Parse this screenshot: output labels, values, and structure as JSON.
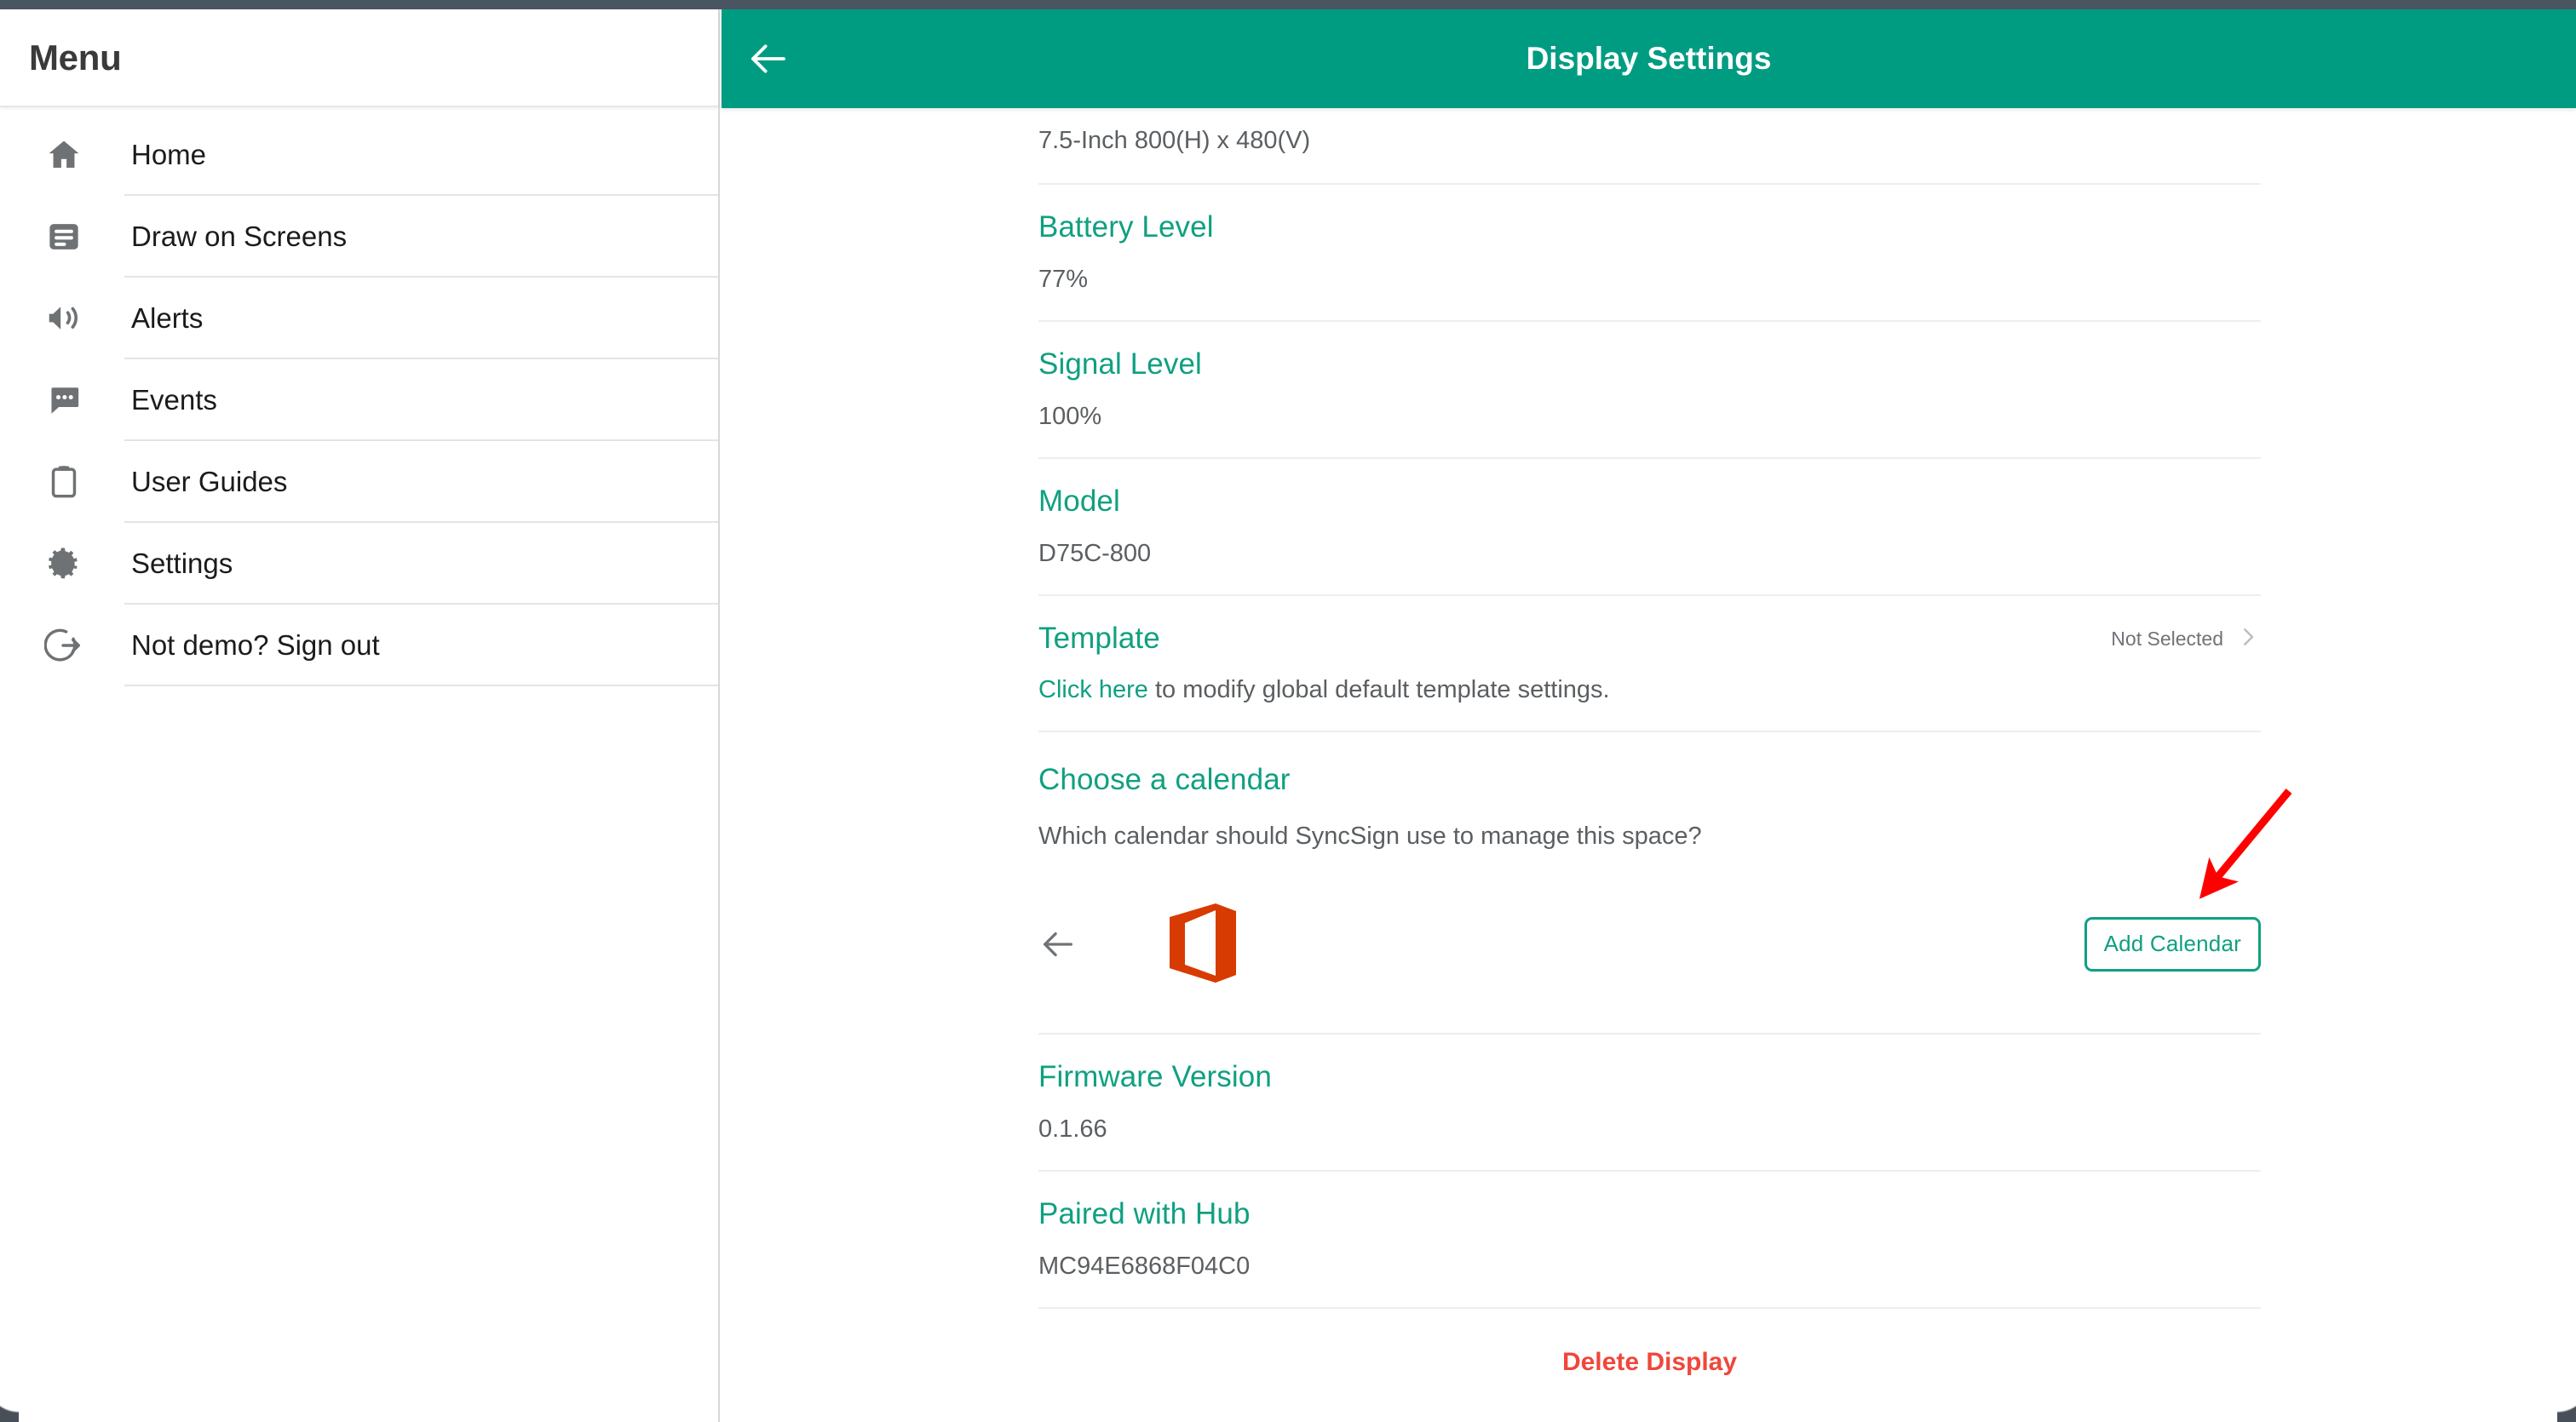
{
  "window": {
    "chrome_color": "#4a5562"
  },
  "sidebar": {
    "title": "Menu",
    "items": [
      {
        "label": "Home",
        "icon": "home-icon"
      },
      {
        "label": "Draw on Screens",
        "icon": "screen-draw-icon"
      },
      {
        "label": "Alerts",
        "icon": "megaphone-icon"
      },
      {
        "label": "Events",
        "icon": "chat-bubble-icon"
      },
      {
        "label": "User Guides",
        "icon": "clipboard-icon"
      },
      {
        "label": "Settings",
        "icon": "gear-icon"
      },
      {
        "label": "Not demo? Sign out",
        "icon": "sign-out-icon"
      }
    ]
  },
  "appbar": {
    "title": "Display Settings",
    "back_icon": "back-arrow-icon",
    "background_color": "#009C82"
  },
  "content": {
    "screen_spec": "7.5-Inch 800(H) x 480(V)",
    "rows": [
      {
        "label": "Battery Level",
        "value": "77%"
      },
      {
        "label": "Signal Level",
        "value": "100%"
      },
      {
        "label": "Model",
        "value": "D75C-800"
      }
    ],
    "template": {
      "label": "Template",
      "status": "Not Selected",
      "chevron_icon": "chevron-right-icon",
      "sub_link": "Click here",
      "sub_text": " to modify global default template settings."
    },
    "calendar": {
      "label": "Choose a calendar",
      "question": "Which calendar should SyncSign use to manage this space?",
      "back_icon": "back-arrow-icon",
      "provider_icon": "office365-logo-icon",
      "add_button": "Add Calendar"
    },
    "footer_rows": [
      {
        "label": "Firmware Version",
        "value": "0.1.66"
      },
      {
        "label": "Paired with Hub",
        "value": "MC94E6868F04C0"
      }
    ],
    "delete_label": "Delete Display"
  },
  "annotation": {
    "arrow_color": "#FF0000",
    "points_to": "Add Calendar"
  },
  "colors": {
    "teal": "#0FA081",
    "appbar_teal": "#009C82",
    "danger_red": "#F0473B",
    "office_orange": "#D83B01",
    "text_grey": "#5b5f62"
  }
}
